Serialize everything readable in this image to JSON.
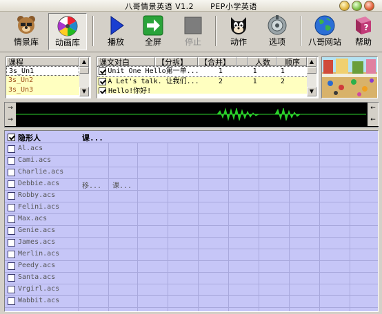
{
  "window": {
    "title_left": "八哥情景英语 V1.2",
    "title_right": "PEP小学英语"
  },
  "toolbar": {
    "buttons": [
      {
        "label": "情景库",
        "icon": "bear-icon"
      },
      {
        "label": "动画库",
        "icon": "film-reel-icon"
      },
      {
        "label": "播放",
        "icon": "play-icon"
      },
      {
        "label": "全屏",
        "icon": "fullscreen-arrow-icon"
      },
      {
        "label": "停止",
        "icon": "stop-icon"
      },
      {
        "label": "动作",
        "icon": "cat-icon"
      },
      {
        "label": "选项",
        "icon": "options-icon"
      },
      {
        "label": "八哥网站",
        "icon": "globe-icon"
      },
      {
        "label": "帮助",
        "icon": "help-book-icon"
      }
    ]
  },
  "lessons": {
    "header": "课程",
    "items": [
      "3s_Un1",
      "3s_Un2",
      "3s_Un3"
    ]
  },
  "dialogue": {
    "headers": [
      "课文对白",
      "【分拆】",
      "【合并】",
      "",
      "人数",
      "顺序"
    ],
    "rows": [
      {
        "checked": true,
        "text": "Unit One   Hello第一单...",
        "c1": "1",
        "c2": "1",
        "c3": "1"
      },
      {
        "checked": true,
        "text": "A  Let's talk. 让我们...",
        "c1": "2",
        "c2": "1",
        "c3": "2"
      },
      {
        "checked": true,
        "text": "Hello!你好!",
        "c1": "",
        "c2": "",
        "c3": ""
      }
    ]
  },
  "characters": {
    "header_check": true,
    "header_name": "隐形人",
    "header_col2": "课...",
    "rows": [
      {
        "name": "Al.acs",
        "col2": "",
        "col3": ""
      },
      {
        "name": "Cami.acs",
        "col2": "",
        "col3": ""
      },
      {
        "name": "Charlie.acs",
        "col2": "",
        "col3": ""
      },
      {
        "name": "Debbie.acs",
        "col2": "移...",
        "col3": "课..."
      },
      {
        "name": "Robby.acs",
        "col2": "",
        "col3": ""
      },
      {
        "name": "Felini.acs",
        "col2": "",
        "col3": ""
      },
      {
        "name": "Max.acs",
        "col2": "",
        "col3": ""
      },
      {
        "name": "Genie.acs",
        "col2": "",
        "col3": ""
      },
      {
        "name": "James.acs",
        "col2": "",
        "col3": ""
      },
      {
        "name": "Merlin.acs",
        "col2": "",
        "col3": ""
      },
      {
        "name": "Peedy.acs",
        "col2": "",
        "col3": ""
      },
      {
        "name": "Santa.acs",
        "col2": "",
        "col3": ""
      },
      {
        "name": "Vrgirl.acs",
        "col2": "",
        "col3": ""
      },
      {
        "name": "Wabbit.acs",
        "col2": "",
        "col3": ""
      }
    ]
  },
  "colors": {
    "grid_bg": "#c6c6f7",
    "highlight": "#ffffc0",
    "wave": "#2bd12b"
  }
}
